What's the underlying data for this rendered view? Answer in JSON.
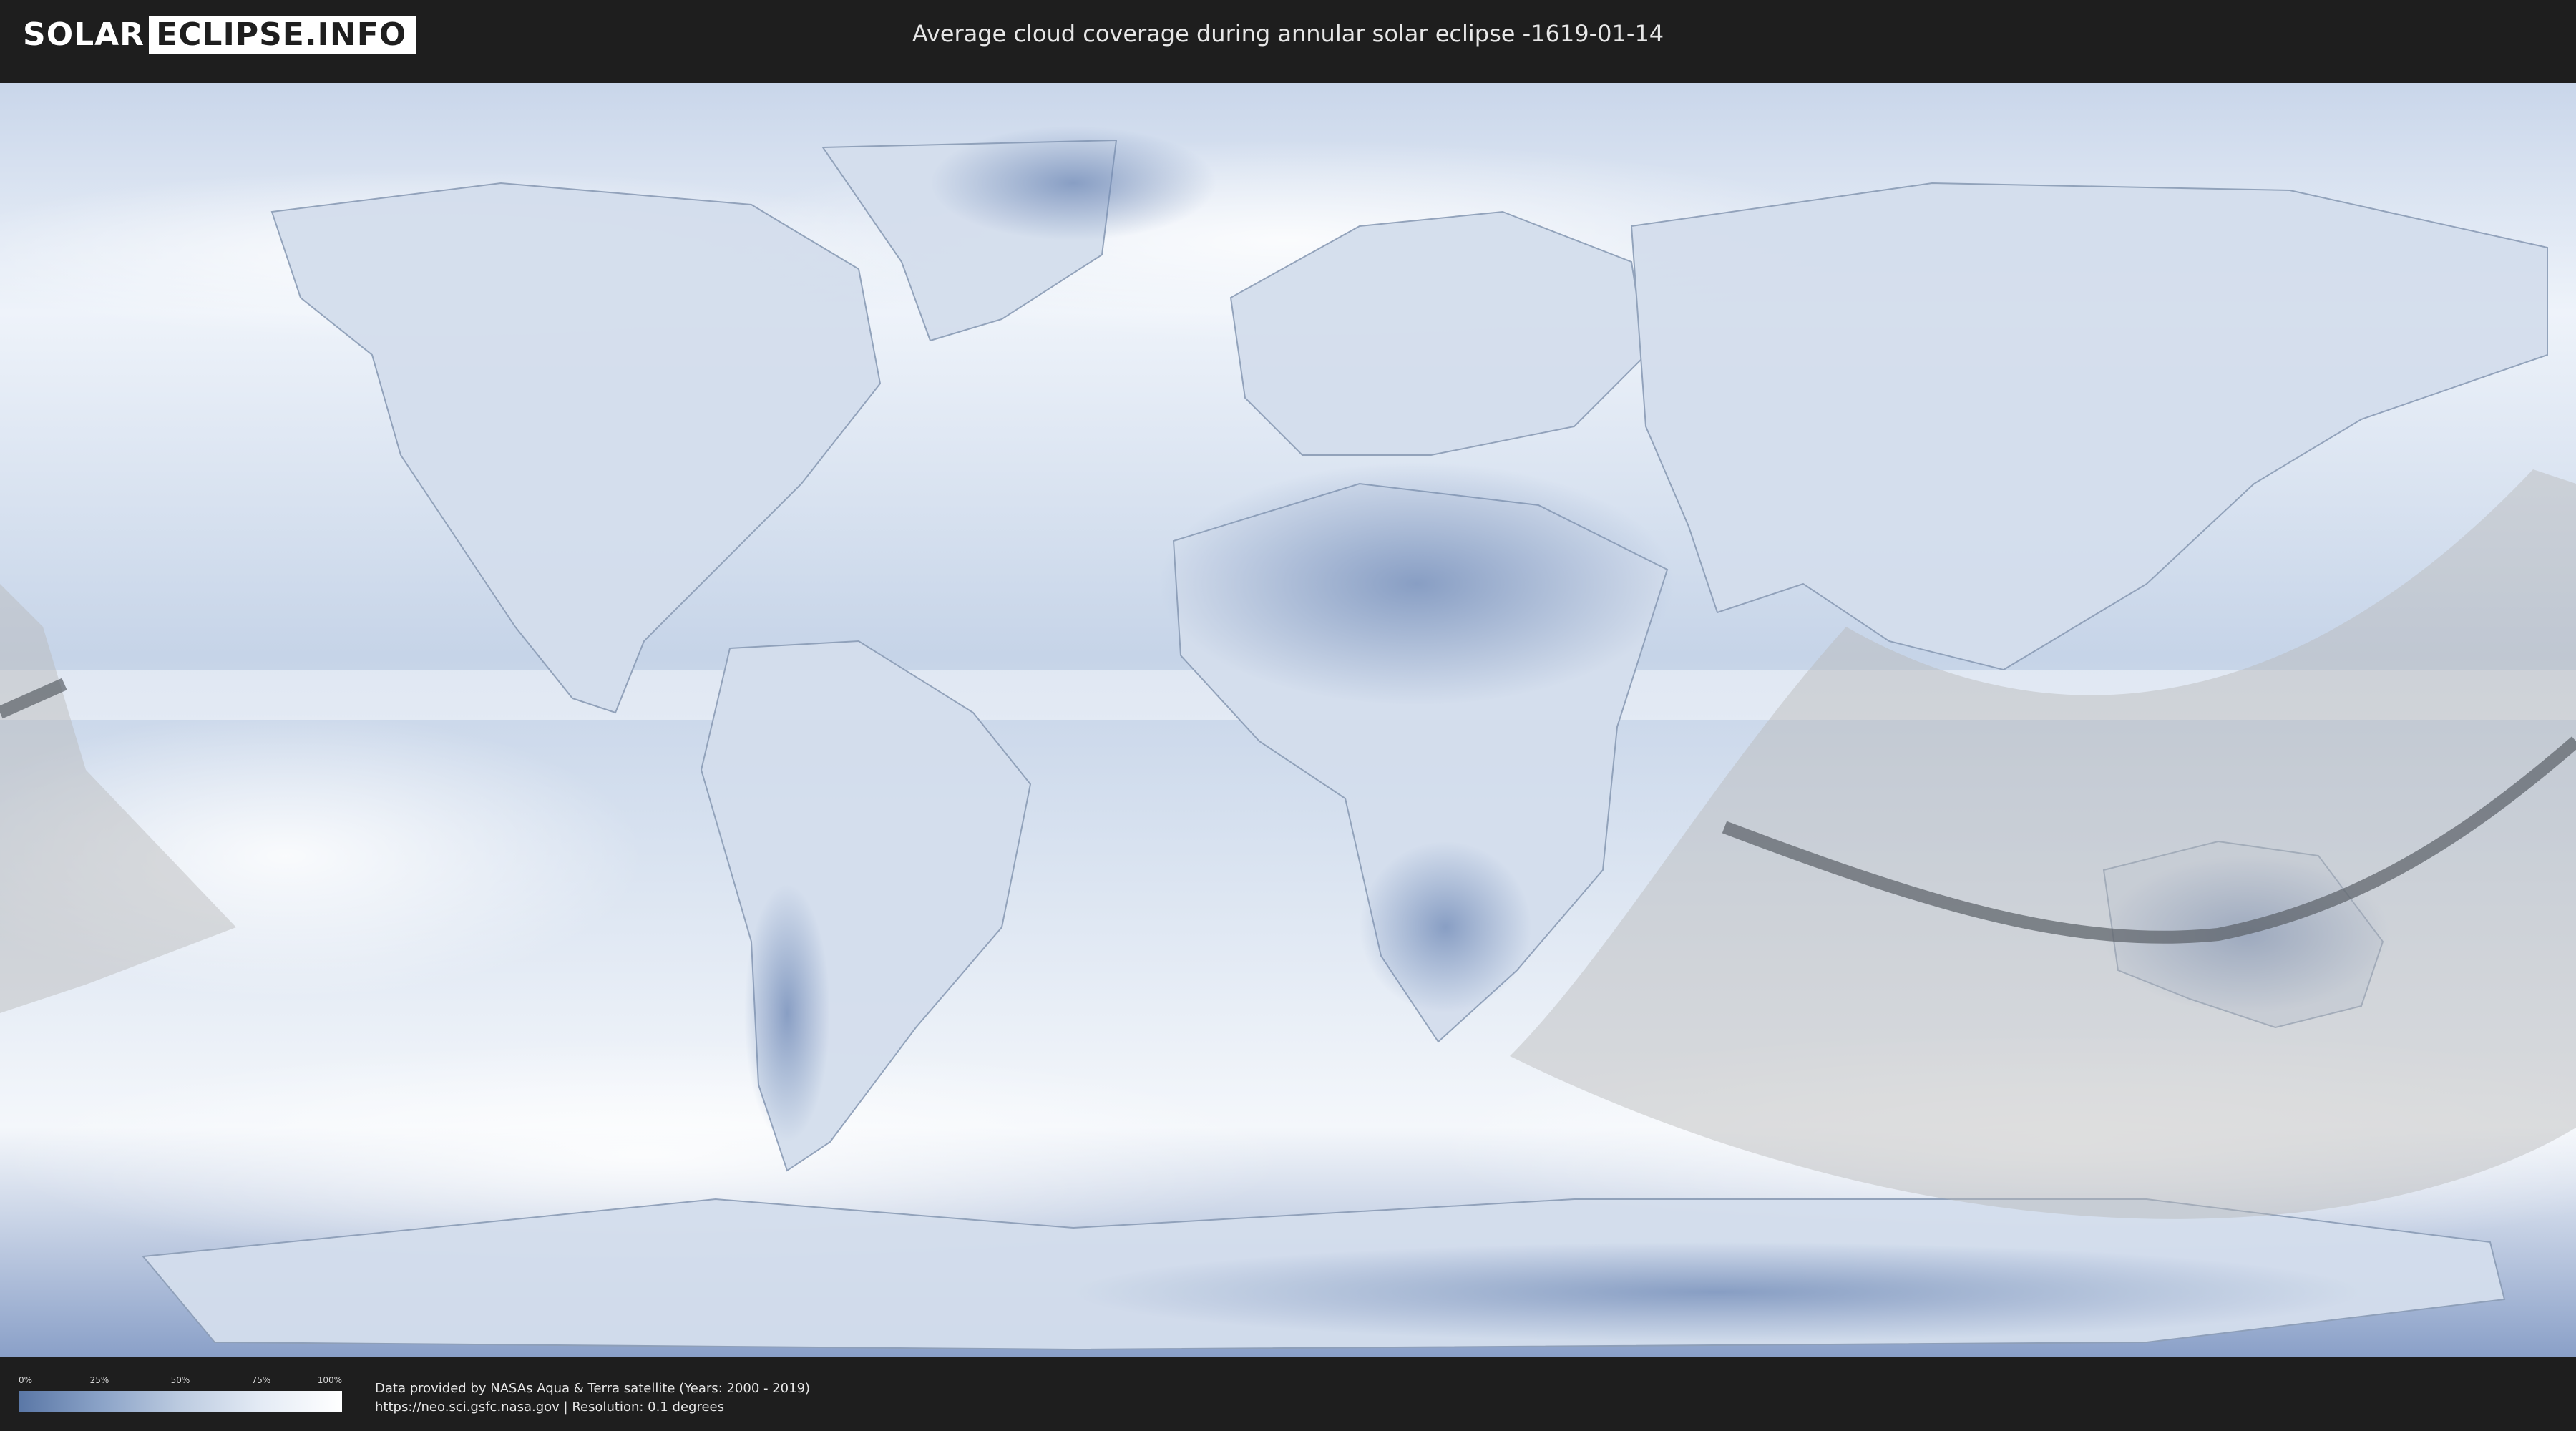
{
  "header": {
    "logo_left": "SOLAR",
    "logo_right": "ECLIPSE.INFO",
    "title": "Average cloud coverage during annular solar eclipse -1619-01-14"
  },
  "map": {
    "description_icon": "world-cloud-coverage-map",
    "colors": {
      "clear": "#5a77a6",
      "cloudy": "#ffffff",
      "eclipse_overlay": "#b9b9b9",
      "central_path": "#5a5f66"
    }
  },
  "legend": {
    "ticks": [
      "0%",
      "25%",
      "50%",
      "75%",
      "100%"
    ]
  },
  "credits": {
    "line1": "Data provided by NASAs Aqua & Terra satellite (Years: 2000 - 2019)",
    "line2": "https://neo.sci.gsfc.nasa.gov | Resolution: 0.1 degrees"
  }
}
